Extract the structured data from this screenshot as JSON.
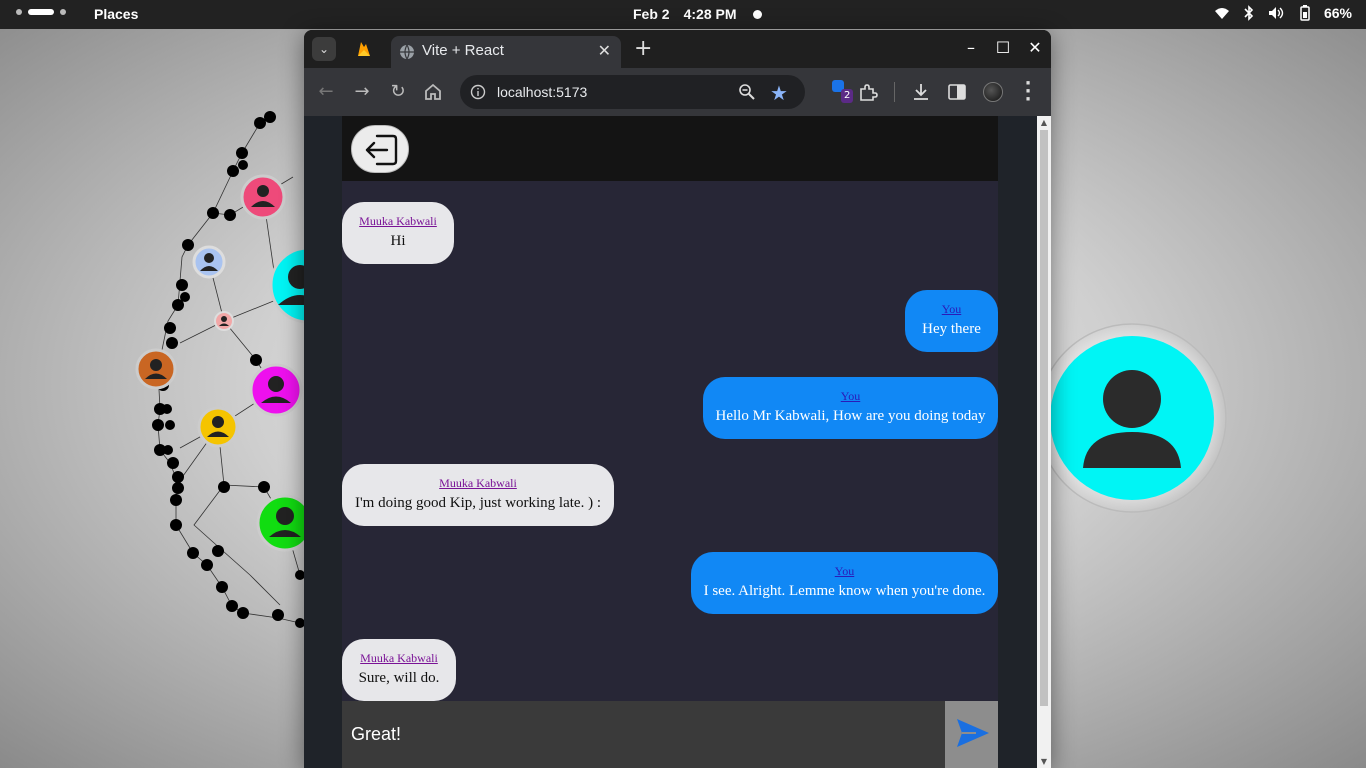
{
  "topbar": {
    "activities": "Places",
    "date": "Feb 2",
    "time": "4:28 PM",
    "battery": "66%"
  },
  "browser": {
    "tab_title": "Vite + React",
    "url": "localhost:5173",
    "extension_badge": "2"
  },
  "chat": {
    "messages": [
      {
        "sender": "Muuka Kabwali",
        "text": "Hi"
      },
      {
        "sender": "You",
        "text": "Hey there"
      },
      {
        "sender": "You",
        "text": "Hello Mr Kabwali, How are you doing today"
      },
      {
        "sender": "Muuka Kabwali",
        "text": "I'm doing good Kip, just working late. ) :"
      },
      {
        "sender": "You",
        "text": "I see. Alright. Lemme know when you're done."
      },
      {
        "sender": "Muuka Kabwali",
        "text": "Sure, will do."
      }
    ],
    "input_value": "Great!"
  },
  "colors": {
    "my_bubble": "#1188f5",
    "their_bubble": "#e7e7ea",
    "chat_bg": "#272636",
    "avatar_accent": "#00f5f5"
  }
}
